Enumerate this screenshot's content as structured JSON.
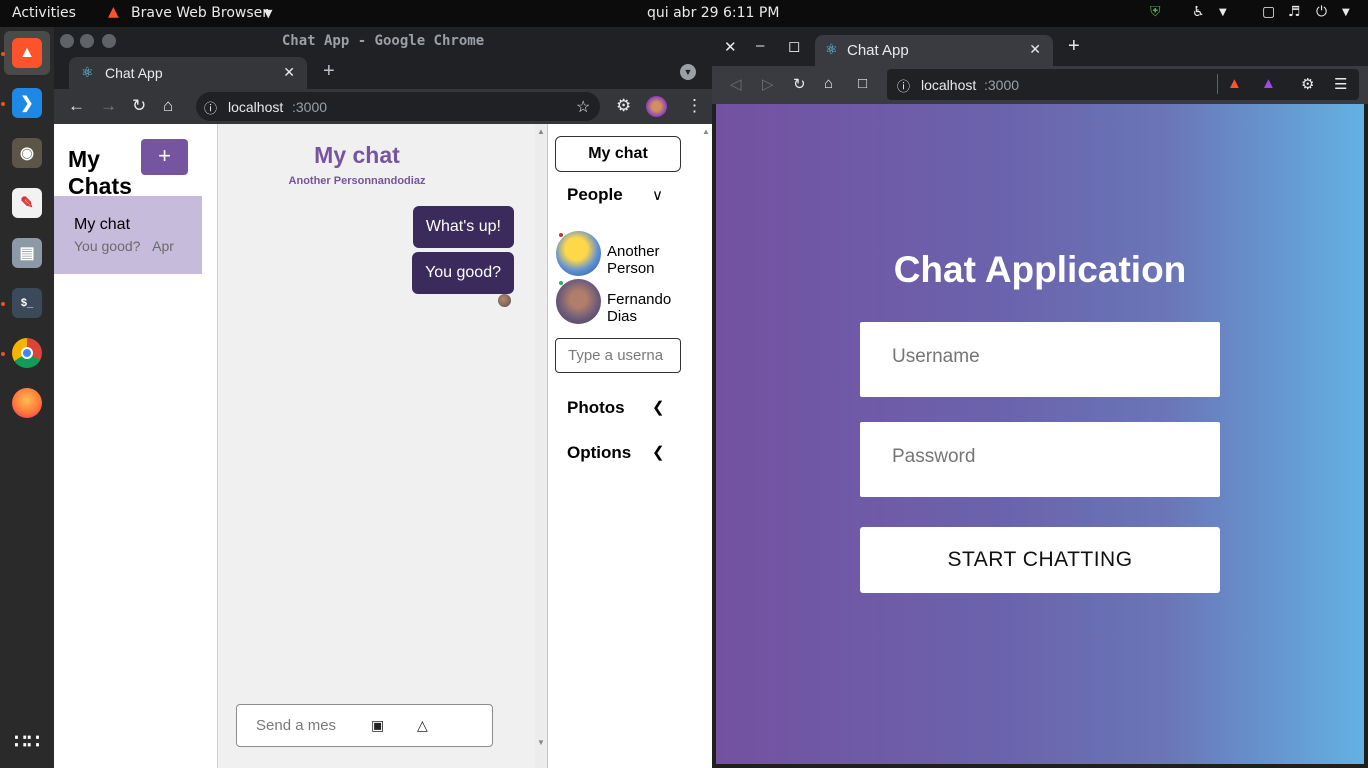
{
  "topbar": {
    "activities": "Activities",
    "app_name": "Brave Web Browser",
    "clock_day": "qui abr 29",
    "clock_time": "6:11 PM"
  },
  "chrome": {
    "window_title": "Chat App - Google Chrome",
    "tab_title": "Chat App",
    "url_host": "localhost",
    "url_port": ":3000"
  },
  "chat": {
    "chats_title": "My Chats",
    "add_label": "+",
    "card_title": "My chat",
    "card_preview": "You good?",
    "card_date": "Apr",
    "feed_title": "My chat",
    "feed_subtitle": "Another Personnandodiaz",
    "messages": [
      "What's up!",
      "You good?"
    ],
    "message_placeholder": "Send a mes",
    "settings_title": "My chat",
    "people_label": "People",
    "people": [
      {
        "name": "Another Person",
        "status_color": "#c0392b"
      },
      {
        "name": "Fernando Dias",
        "status_color": "#27ae60"
      }
    ],
    "username_placeholder": "Type a userna",
    "photos_label": "Photos",
    "options_label": "Options"
  },
  "brave": {
    "tab_title": "Chat App",
    "url_host": "localhost",
    "url_port": ":3000",
    "login_title": "Chat Application",
    "username_placeholder": "Username",
    "password_placeholder": "Password",
    "start_label": "START CHATTING"
  },
  "colors": {
    "accent": "#7554a0",
    "bubble": "#3b2a5c"
  }
}
